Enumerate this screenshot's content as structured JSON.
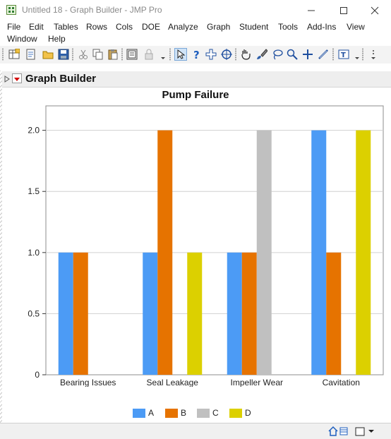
{
  "window": {
    "title": "Untitled 18 - Graph Builder - JMP Pro"
  },
  "menu": {
    "items": [
      "File",
      "Edit",
      "Tables",
      "Rows",
      "Cols",
      "DOE",
      "Analyze",
      "Graph",
      "Student",
      "Tools",
      "Add-Ins",
      "View",
      "Window",
      "Help"
    ]
  },
  "toolbar": {
    "icons": [
      "new-data-table-icon",
      "new-script-icon",
      "open-file-icon",
      "save-icon",
      "cut-icon",
      "copy-icon",
      "paste-icon",
      "data-grid-icon",
      "lock-icon",
      "arrow-tool-icon",
      "help-tool-icon",
      "selection-tool-icon",
      "crosshair-icon",
      "hand-tool-icon",
      "brush-tool-icon",
      "lasso-tool-icon",
      "magnifier-icon",
      "add-tool-icon",
      "line-tool-icon",
      "text-annotation-icon"
    ]
  },
  "outline": {
    "title": "Graph Builder"
  },
  "chart_data": {
    "type": "bar",
    "title": "Pump Failure",
    "xlabel": "",
    "ylabel": "",
    "categories": [
      "Bearing Issues",
      "Seal Leakage",
      "Impeller Wear",
      "Cavitation"
    ],
    "series": [
      {
        "name": "A",
        "color": "#4c9bf5",
        "values": [
          1,
          1,
          1,
          2
        ]
      },
      {
        "name": "B",
        "color": "#e67300",
        "values": [
          1,
          2,
          1,
          1
        ]
      },
      {
        "name": "C",
        "color": "#c0c0c0",
        "values": [
          0,
          0,
          2,
          0
        ]
      },
      {
        "name": "D",
        "color": "#dcd000",
        "values": [
          0,
          1,
          0,
          2
        ]
      }
    ],
    "ylim": [
      0,
      2.2
    ],
    "yticks": [
      "0",
      "0.5",
      "1.0",
      "1.5",
      "2.0"
    ],
    "grid": true,
    "legend": "bottom-center"
  }
}
